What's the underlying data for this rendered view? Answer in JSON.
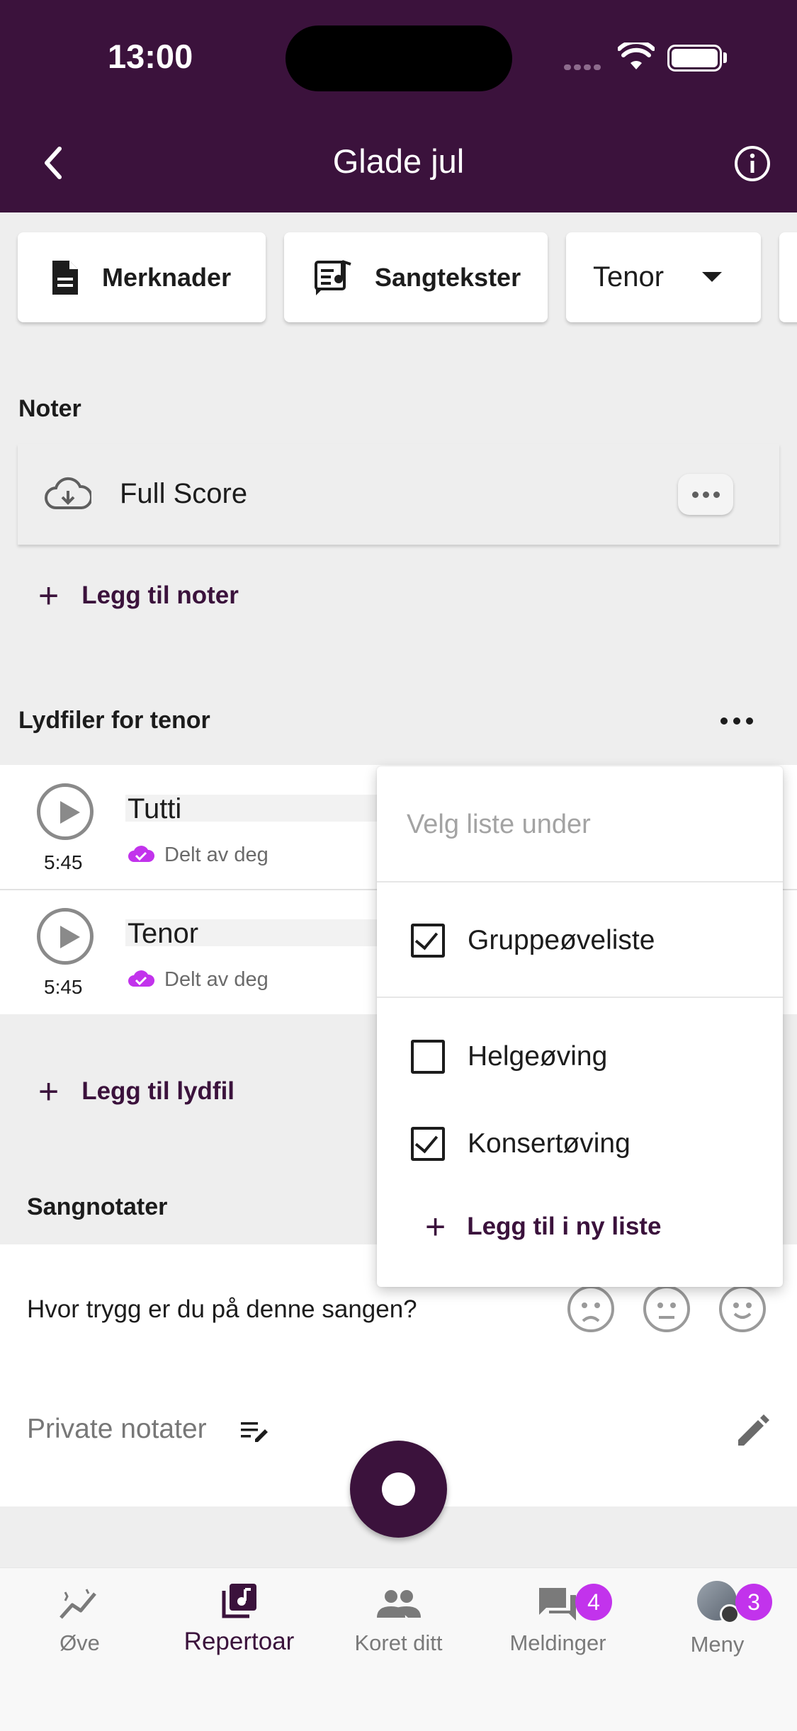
{
  "status": {
    "time": "13:00"
  },
  "header": {
    "title": "Glade jul"
  },
  "chips": {
    "notes": "Merknader",
    "lyrics": "Sangtekster",
    "voice": "Tenor"
  },
  "scores": {
    "title": "Noter",
    "item": "Full Score",
    "add": "Legg til noter"
  },
  "audio": {
    "title": "Lydfiler for tenor",
    "tracks": [
      {
        "name": "Tutti",
        "duration": "5:45",
        "shared": "Delt av deg"
      },
      {
        "name": "Tenor",
        "duration": "5:45",
        "shared": "Delt av deg"
      }
    ],
    "add": "Legg til lydfil"
  },
  "song_notes": {
    "title": "Sangnotater",
    "question": "Hvor trygg er du på denne sangen?",
    "private": "Private notater"
  },
  "menu": {
    "header": "Velg liste under",
    "items": [
      {
        "label": "Gruppeøveliste",
        "checked": true
      },
      {
        "label": "Helgeøving",
        "checked": false
      },
      {
        "label": "Konsertøving",
        "checked": true
      }
    ],
    "add": "Legg til i ny liste"
  },
  "nav": {
    "items": [
      {
        "label": "Øve"
      },
      {
        "label": "Repertoar",
        "active": true
      },
      {
        "label": "Koret ditt"
      },
      {
        "label": "Meldinger",
        "badge": "4"
      },
      {
        "label": "Meny",
        "badge": "3"
      }
    ]
  },
  "colors": {
    "brand": "#3b123c",
    "accent": "#c233ec"
  }
}
